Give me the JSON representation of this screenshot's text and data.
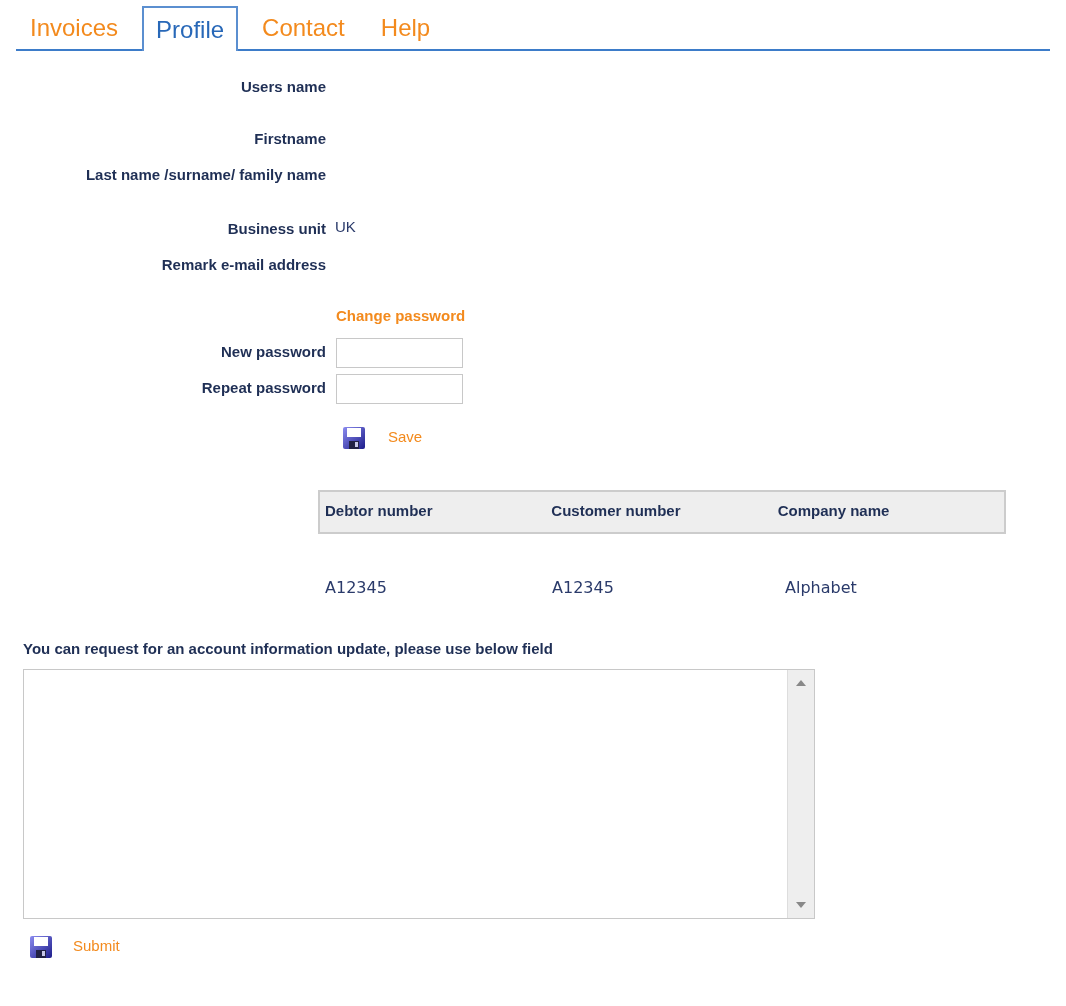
{
  "tabs": [
    {
      "label": "Invoices",
      "selected": false
    },
    {
      "label": "Profile",
      "selected": true
    },
    {
      "label": "Contact",
      "selected": false
    },
    {
      "label": "Help",
      "selected": false
    }
  ],
  "profile_fields": [
    {
      "label": "Users name"
    },
    {
      "label": "Firstname"
    },
    {
      "label": "Last name /surname/ family name"
    },
    {
      "label": "Business unit",
      "value": "UK"
    },
    {
      "label": "Remark e-mail address"
    }
  ],
  "change_password": {
    "title": "Change password",
    "fields": [
      {
        "label": "New password"
      },
      {
        "label": "Repeat password"
      }
    ],
    "save": "Save"
  },
  "table": {
    "columns": [
      "Debtor number",
      "Customer number",
      "Company name"
    ],
    "rows": [
      [
        "A12345",
        "A12345",
        "Alphabet"
      ]
    ]
  },
  "request": {
    "label": "You can request for an account information update, please use below field",
    "submit": "Submit"
  }
}
